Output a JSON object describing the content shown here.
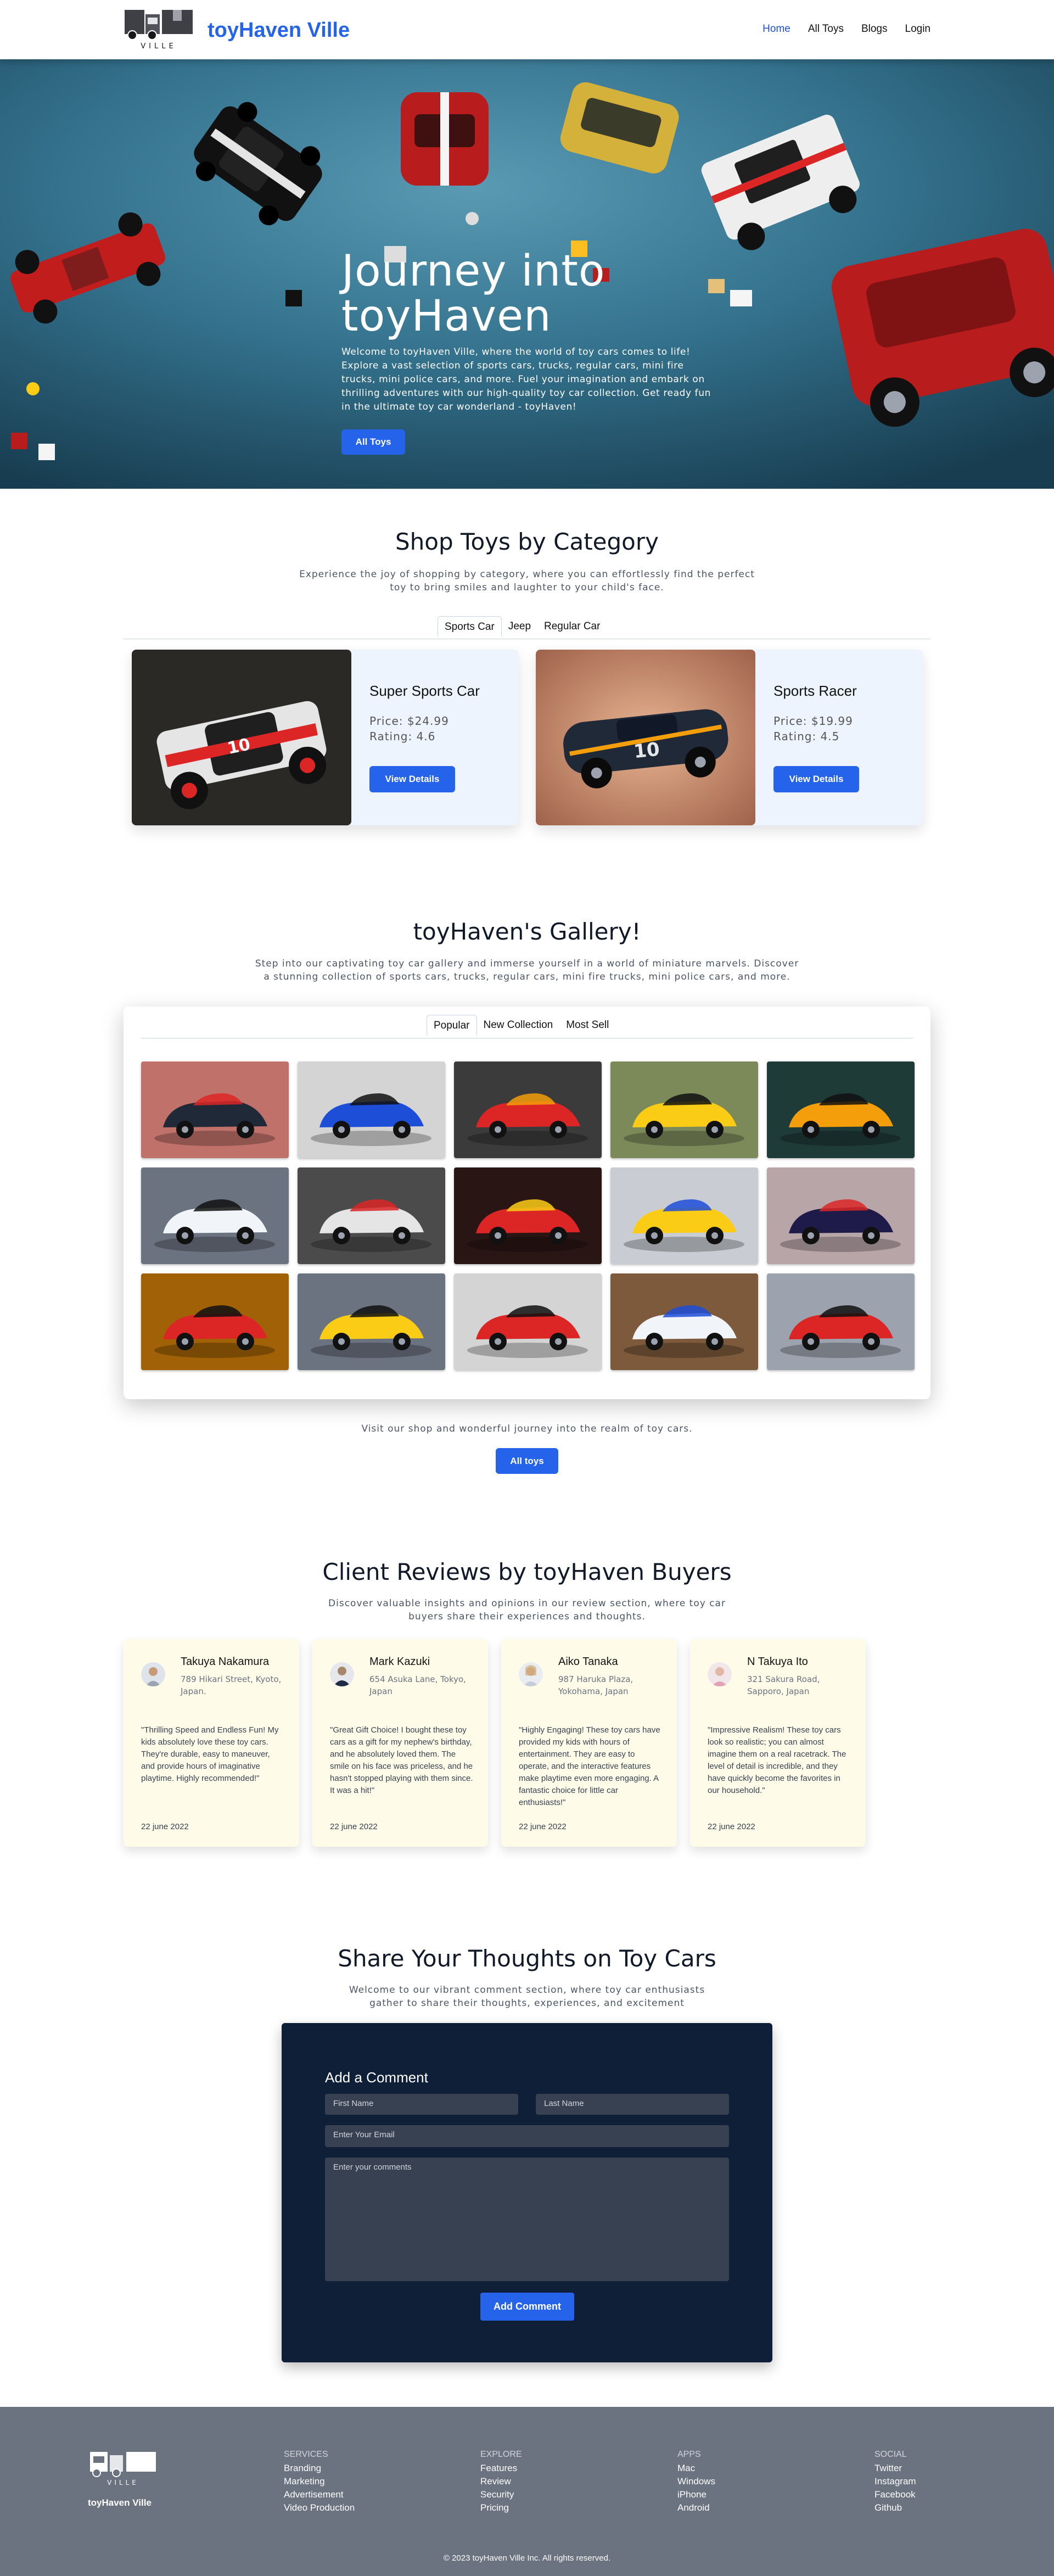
{
  "nav": {
    "logo_text": "VILLE",
    "brand": "toyHaven Ville",
    "links": [
      "Home",
      "All Toys",
      "Blogs",
      "Login"
    ]
  },
  "hero": {
    "title": "Journey into toyHaven",
    "description": "Welcome to toyHaven Ville, where the world of toy cars comes to life! Explore a vast selection of sports cars, trucks, regular cars, mini fire trucks, mini police cars, and more. Fuel your imagination and embark on thrilling adventures with our high-quality toy car collection. Get ready fun in the ultimate toy car wonderland - toyHaven!",
    "button": "All Toys"
  },
  "category": {
    "title": "Shop Toys by Category",
    "subtitle": "Experience the joy of shopping by category, where you can effortlessly find the perfect toy to bring smiles and laughter to your child's face.",
    "tabs": [
      "Sports Car",
      "Jeep",
      "Regular Car"
    ],
    "active_tab": "Sports Car",
    "products": [
      {
        "name": "Super Sports Car",
        "price": "Price: $24.99",
        "rating": "Rating: 4.6",
        "button": "View Details"
      },
      {
        "name": "Sports Racer",
        "price": "Price: $19.99",
        "rating": "Rating: 4.5",
        "button": "View Details"
      }
    ]
  },
  "gallery": {
    "title": "toyHaven's Gallery!",
    "subtitle": "Step into our captivating toy car gallery and immerse yourself in a world of miniature marvels. Discover a stunning collection of sports cars, trucks, regular cars, mini fire trucks, mini police cars, and more.",
    "tabs": [
      "Popular",
      "New Collection",
      "Most Sell"
    ],
    "active_tab": "Popular",
    "footer_text": "Visit our shop and wonderful journey into the realm of toy cars.",
    "button": "All toys"
  },
  "reviews": {
    "title": "Client Reviews by toyHaven Buyers",
    "subtitle": "Discover valuable insights and opinions in our review section, where toy car buyers share their experiences and thoughts.",
    "items": [
      {
        "name": "Takuya Nakamura",
        "address": "789 Hikari Street, Kyoto, Japan.",
        "text": "\"Thrilling Speed and Endless Fun! My kids absolutely love these toy cars. They're durable, easy to maneuver, and provide hours of imaginative playtime. Highly recommended!\"",
        "date": "22 june 2022"
      },
      {
        "name": "Mark Kazuki",
        "address": "654 Asuka Lane, Tokyo, Japan",
        "text": "\"Great Gift Choice! I bought these toy cars as a gift for my nephew's birthday, and he absolutely loved them. The smile on his face was priceless, and he hasn't stopped playing with them since. It was a hit!\"",
        "date": "22 june 2022"
      },
      {
        "name": "Aiko Tanaka",
        "address": "987 Haruka Plaza, Yokohama, Japan",
        "text": "\"Highly Engaging! These toy cars have provided my kids with hours of entertainment. They are easy to operate, and the interactive features make playtime even more engaging. A fantastic choice for little car enthusiasts!\"",
        "date": "22 june 2022"
      },
      {
        "name": "N Takuya Ito",
        "address": "321 Sakura Road, Sapporo, Japan",
        "text": "\"Impressive Realism! These toy cars look so realistic; you can almost imagine them on a real racetrack. The level of detail is incredible, and they have quickly become the favorites in our household.\"",
        "date": "22 june 2022"
      }
    ]
  },
  "comments": {
    "title": "Share Your Thoughts on Toy Cars",
    "subtitle": "Welcome to our vibrant comment section, where toy car enthusiasts gather to share their thoughts, experiences, and excitement",
    "form_title": "Add a Comment",
    "first_name_placeholder": "First Name",
    "last_name_placeholder": "Last Name",
    "email_placeholder": "Enter Your Email",
    "comments_placeholder": "Enter your comments",
    "button": "Add Comment"
  },
  "footer": {
    "brand": "toyHaven Ville",
    "logo_text": "VILLE",
    "columns": [
      {
        "heading": "SERVICES",
        "items": [
          "Branding",
          "Marketing",
          "Advertisement",
          "Video Production"
        ]
      },
      {
        "heading": "EXPLORE",
        "items": [
          "Features",
          "Review",
          "Security",
          "Pricing"
        ]
      },
      {
        "heading": "APPS",
        "items": [
          "Mac",
          "Windows",
          "iPhone",
          "Android"
        ]
      },
      {
        "heading": "SOCIAL",
        "items": [
          "Twitter",
          "Instagram",
          "Facebook",
          "Github"
        ]
      }
    ],
    "copyright": "© 2023 toyHaven Ville Inc. All rights reserved."
  },
  "colors": {
    "accent": "#2563eb",
    "form_bg": "#0f1f38",
    "footer_bg": "#6b7280",
    "review_bg": "#fefce8",
    "product_bg": "#eef4fd"
  }
}
